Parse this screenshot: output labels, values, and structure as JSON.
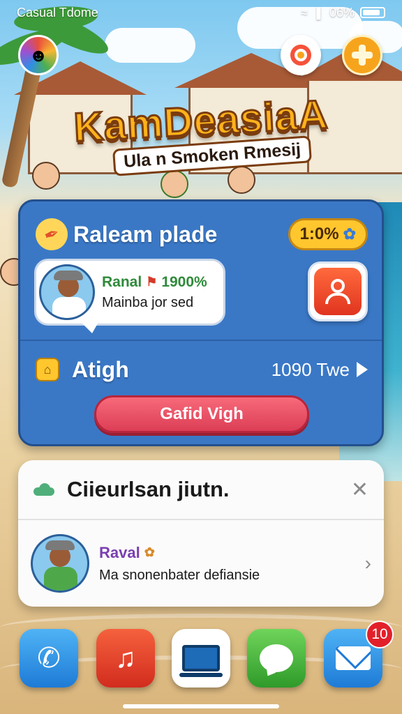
{
  "status_bar": {
    "app_name": "Casual Tdome",
    "signal_text": "06%"
  },
  "logo": {
    "title": "KamDeasiaA",
    "subtitle": "Ula n Smoken Rmesij"
  },
  "main_card": {
    "title": "Raleam plade",
    "score": "1:0%",
    "chat": {
      "name": "Ranal",
      "percent": "1900%",
      "message": "Mainba jor sed"
    },
    "section_label": "Atigh",
    "section_value": "1090 Twe",
    "action_label": "Gafid Vigh"
  },
  "notification": {
    "title": "Ciieurlsan jiutn.",
    "name": "Raval",
    "message": "Ma snonenbater defiansie"
  },
  "dock": {
    "mail_badge": "10",
    "icons": [
      "phone-icon",
      "music-icon",
      "laptop-icon",
      "messages-icon",
      "mail-icon"
    ]
  },
  "colors": {
    "card_blue": "#3a78c6",
    "score_yellow": "#ffc62e",
    "action_pink": "#dc3e56",
    "badge_red": "#e2202a",
    "logo_orange": "#ffb21b"
  }
}
